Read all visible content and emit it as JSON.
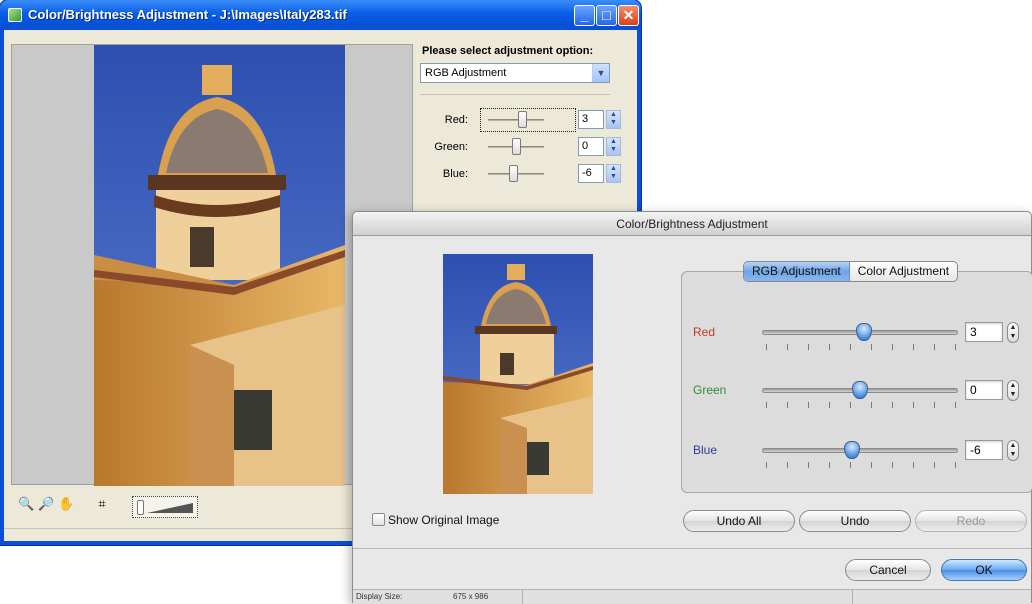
{
  "xp_window": {
    "title": "Color/Brightness Adjustment - J:\\Images\\Italy283.tif",
    "controls": {
      "minimize": "_",
      "maximize": "□",
      "close": "✕"
    },
    "option_label": "Please select adjustment option:",
    "option_value": "RGB Adjustment",
    "sliders": [
      {
        "label": "Red:",
        "value": "3",
        "level": 0.6
      },
      {
        "label": "Green:",
        "value": "0",
        "level": 0.5
      },
      {
        "label": "Blue:",
        "value": "-6",
        "level": 0.45
      }
    ],
    "tools": [
      "zoom-in-icon",
      "zoom-out-icon",
      "hand-pan-icon",
      "fit-to-window-icon"
    ]
  },
  "mac_window": {
    "title": "Color/Brightness Adjustment",
    "tabs": [
      "RGB Adjustment",
      "Color Adjustment"
    ],
    "active_tab": "RGB Adjustment",
    "sliders": [
      {
        "label": "Red",
        "value": "3",
        "level": 0.52,
        "color": "#c0392b"
      },
      {
        "label": "Green",
        "value": "0",
        "level": 0.5,
        "color": "#2e8b3a"
      },
      {
        "label": "Blue",
        "value": "-6",
        "level": 0.46,
        "color": "#2a3f9e"
      }
    ],
    "show_original_label": "Show Original Image",
    "buttons": {
      "undo_all": "Undo All",
      "undo": "Undo",
      "redo": "Redo",
      "cancel": "Cancel",
      "ok": "OK"
    },
    "status": {
      "display_size_label": "Display Size:",
      "display_size_value": "675 x 986"
    }
  }
}
